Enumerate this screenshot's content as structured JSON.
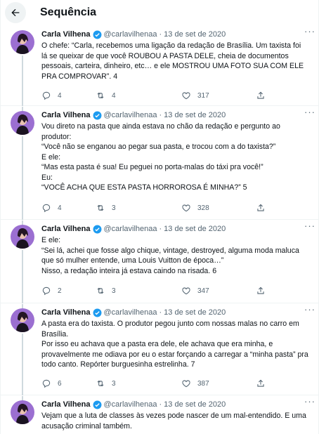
{
  "header": {
    "title": "Sequência",
    "back_icon": "arrow-left-icon"
  },
  "author": {
    "name": "Carla Vilhena",
    "handle": "@carlavilhenaa",
    "sep": "·",
    "verified_color": "#1d9bf0"
  },
  "tweets": [
    {
      "date": "13 de set de 2020",
      "lines": [
        "O chefe: “Carla, recebemos uma ligação da redação de Brasília. Um taxista foi lá se queixar de que você ROUBOU A PASTA DELE, cheia de documentos pessoais, carteira, dinheiro, etc… e ele MOSTROU UMA FOTO SUA COM ELE PRA COMPROVAR”. 4"
      ],
      "replies": "4",
      "retweets": "4",
      "likes": "317"
    },
    {
      "date": "13 de set de 2020",
      "lines": [
        "Vou direto na pasta que ainda estava no chão da redação e pergunto ao produtor:",
        "“Você não se enganou ao pegar sua pasta, e trocou com a do taxista?”",
        "E ele:",
        "“Mas esta pasta é sua! Eu peguei no porta-malas do táxi pra você!”",
        "Eu:",
        "“VOCÊ ACHA QUE ESTA PASTA HORROROSA É MINHA?” 5"
      ],
      "replies": "4",
      "retweets": "3",
      "likes": "328"
    },
    {
      "date": "13 de set de 2020",
      "lines": [
        "E ele:",
        "“Sei lá, achei que fosse algo chique, vintage, destroyed, alguma moda maluca que só mulher entende, uma Louis Vuitton de época…”",
        "Nisso, a redação inteira já estava caindo na risada. 6"
      ],
      "replies": "2",
      "retweets": "3",
      "likes": "347"
    },
    {
      "date": "13 de set de 2020",
      "lines": [
        "A pasta era do taxista. O produtor pegou junto com nossas malas no carro em Brasília.",
        "Por isso eu achava que a pasta era dele, ele achava que era minha, e provavelmente me odiava por eu o estar forçando a carregar a “minha pasta” pra todo canto. Repórter burguesinha estrelinha. 7"
      ],
      "replies": "6",
      "retweets": "3",
      "likes": "387"
    },
    {
      "date": "13 de set de 2020",
      "lines": [
        "Vejam que a luta de classes às vezes pode nascer de um mal-entendido. E uma acusação criminal também."
      ],
      "replies": "",
      "retweets": "",
      "likes": ""
    }
  ],
  "icons": {
    "reply": "reply-icon",
    "retweet": "retweet-icon",
    "like": "heart-icon",
    "share": "share-icon",
    "more": "more-options-icon",
    "verified": "verified-badge-icon"
  },
  "colors": {
    "text": "#0f1419",
    "secondary": "#536471",
    "divider": "#eff3f4",
    "thread": "#cfd9de",
    "verified": "#1d9bf0"
  }
}
